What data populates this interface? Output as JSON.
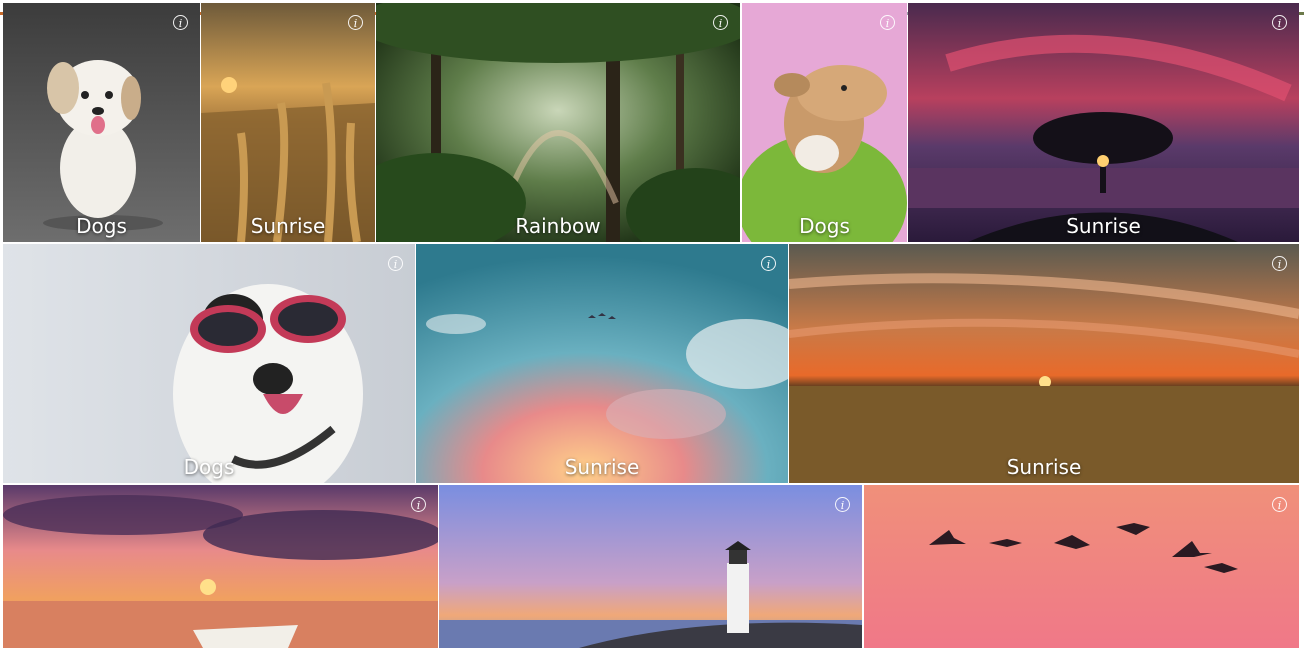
{
  "tiles": [
    {
      "caption": "Dogs"
    },
    {
      "caption": "Sunrise"
    },
    {
      "caption": "Rainbow"
    },
    {
      "caption": "Dogs"
    },
    {
      "caption": "Sunrise"
    },
    {
      "caption": "Dogs"
    },
    {
      "caption": "Sunrise"
    },
    {
      "caption": "Sunrise"
    },
    {
      "caption": ""
    },
    {
      "caption": ""
    },
    {
      "caption": ""
    }
  ],
  "info_glyph": "i"
}
